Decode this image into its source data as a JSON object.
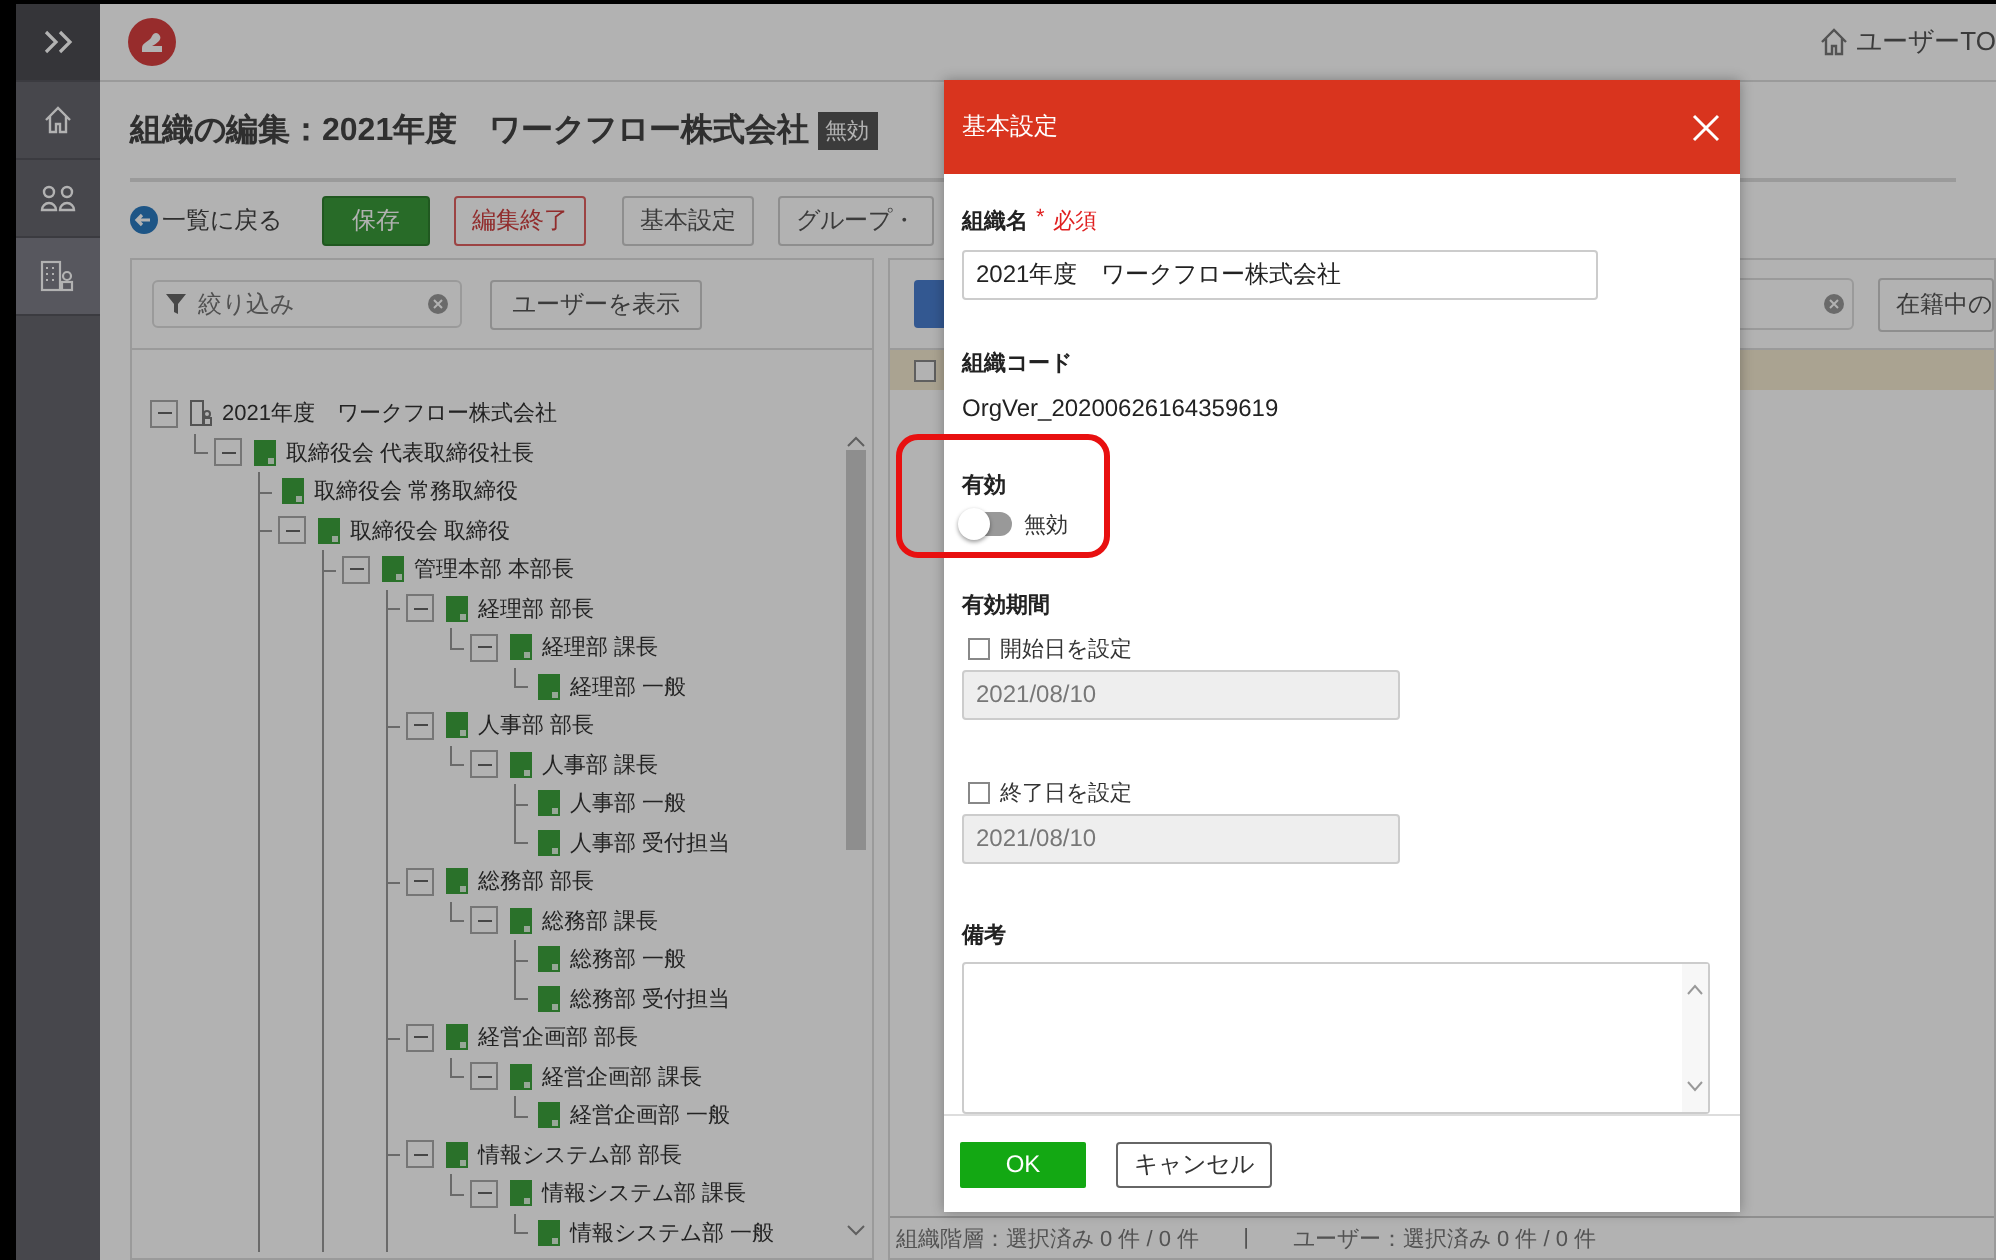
{
  "sidebar": {
    "items": [
      {
        "selected": false
      },
      {
        "selected": false
      },
      {
        "selected": true
      }
    ]
  },
  "top_bar": {
    "user_link": "ユーザーTO"
  },
  "page": {
    "title": "組織の編集：2021年度　ワークフロー株式会社",
    "status_badge": "無効"
  },
  "toolbar": {
    "back_link": "一覧に戻る",
    "buttons": [
      {
        "label": "保存",
        "kind": "primary"
      },
      {
        "label": "編集終了",
        "kind": "danger"
      },
      {
        "label": "基本設定",
        "kind": "plain"
      },
      {
        "label": "グループ・",
        "kind": "plain"
      }
    ]
  },
  "tree_panel": {
    "filter": {
      "placeholder": "絞り込み"
    },
    "show_users_button": "ユーザーを表示",
    "root": {
      "label": "2021年度　ワークフロー株式会社",
      "expanded": true,
      "children": [
        {
          "label": "取締役会 代表取締役社長",
          "expanded": true,
          "children": [
            {
              "label": "取締役会 常務取締役"
            },
            {
              "label": "取締役会 取締役",
              "expanded": true,
              "more_below": true,
              "children": [
                {
                  "label": "管理本部 本部長",
                  "expanded": true,
                  "more_below": true,
                  "children": [
                    {
                      "label": "経理部 部長",
                      "expanded": true,
                      "children": [
                        {
                          "label": "経理部 課長",
                          "expanded": true,
                          "children": [
                            {
                              "label": "経理部 一般"
                            }
                          ]
                        }
                      ]
                    },
                    {
                      "label": "人事部 部長",
                      "expanded": true,
                      "children": [
                        {
                          "label": "人事部 課長",
                          "expanded": true,
                          "children": [
                            {
                              "label": "人事部 一般"
                            },
                            {
                              "label": "人事部 受付担当"
                            }
                          ]
                        }
                      ]
                    },
                    {
                      "label": "総務部 部長",
                      "expanded": true,
                      "children": [
                        {
                          "label": "総務部 課長",
                          "expanded": true,
                          "children": [
                            {
                              "label": "総務部 一般"
                            },
                            {
                              "label": "総務部 受付担当"
                            }
                          ]
                        }
                      ]
                    },
                    {
                      "label": "経営企画部 部長",
                      "expanded": true,
                      "children": [
                        {
                          "label": "経営企画部 課長",
                          "expanded": true,
                          "children": [
                            {
                              "label": "経営企画部 一般"
                            }
                          ]
                        }
                      ]
                    },
                    {
                      "label": "情報システム部 部長",
                      "expanded": true,
                      "more_below": true,
                      "children": [
                        {
                          "label": "情報システム部 課長",
                          "expanded": true,
                          "children": [
                            {
                              "label": "情報システム部 一般"
                            }
                          ]
                        }
                      ]
                    }
                  ]
                }
              ]
            }
          ]
        }
      ]
    }
  },
  "user_panel": {
    "status_filter_button": "在籍中の",
    "header_checkbox": {
      "checked": false
    }
  },
  "status_bar": {
    "groups": "組織階層：選択済み 0 件 / 0 件",
    "separator": "|",
    "users": "ユーザー：選択済み 0 件 / 0 件"
  },
  "dialog": {
    "title": "基本設定",
    "name_field": {
      "label": "組織名",
      "required_mark": "*",
      "required_text": "必須",
      "value": "2021年度　ワークフロー株式会社"
    },
    "code_field": {
      "label": "組織コード",
      "value": "OrgVer_20200626164359619"
    },
    "enabled_field": {
      "label": "有効",
      "on": false,
      "state_text": "無効",
      "highlighted": true
    },
    "period": {
      "label": "有効期間",
      "start": {
        "label": "開始日を設定",
        "checked": false,
        "value": "2021/08/10",
        "disabled": true
      },
      "end": {
        "label": "終了日を設定",
        "checked": false,
        "value": "2021/08/10",
        "disabled": true
      }
    },
    "remarks": {
      "label": "備考"
    },
    "ok_button": "OK",
    "cancel_button": "キャンセル"
  }
}
